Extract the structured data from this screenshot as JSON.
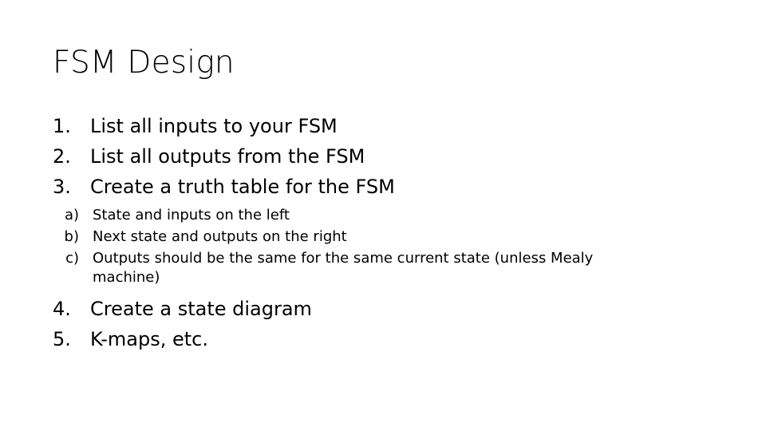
{
  "slide": {
    "title": "FSM Design",
    "background_color": "#ffffff",
    "text_color": "#000000",
    "steps": [
      {
        "marker": "1.",
        "text": "List all inputs to your FSM"
      },
      {
        "marker": "2.",
        "text": "List all outputs from the FSM"
      },
      {
        "marker": "3.",
        "text": "Create a truth table for the FSM"
      },
      {
        "marker": "4.",
        "text": "Create a state diagram"
      },
      {
        "marker": "5.",
        "text": "K-maps, etc."
      }
    ],
    "substeps": [
      {
        "marker": "a)",
        "text": "State and inputs on the left"
      },
      {
        "marker": "b)",
        "text": "Next state and outputs on the right"
      },
      {
        "marker": "c)",
        "text": "Outputs should be the same for the same current state (unless Mealy machine)"
      }
    ]
  }
}
